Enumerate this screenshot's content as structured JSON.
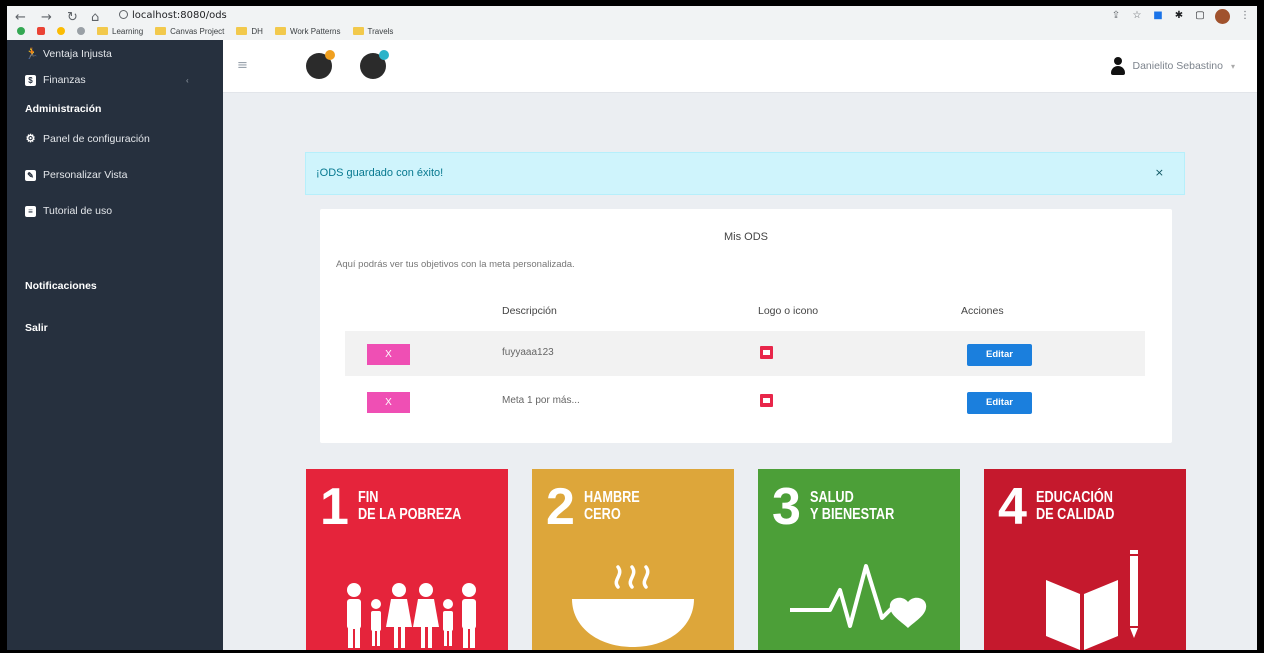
{
  "browser": {
    "url": "localhost:8080/ods",
    "bookmarks": [
      "Learning",
      "Canvas Project",
      "DH",
      "Work Patterns",
      "Travels"
    ]
  },
  "sidebar": {
    "items": [
      {
        "label": "Ventaja Injusta",
        "icon": "running-person-icon"
      },
      {
        "label": "Finanzas",
        "icon": "dollar-icon"
      }
    ],
    "admin_heading": "Administración",
    "admin_items": [
      {
        "label": "Panel de configuración",
        "icon": "gear-icon"
      },
      {
        "label": "Personalizar Vista",
        "icon": "palette-icon"
      },
      {
        "label": "Tutorial de uso",
        "icon": "book-icon"
      }
    ],
    "notifications": "Notificaciones",
    "logout": "Salir"
  },
  "topbar": {
    "user_name": "Danielito Sebastino"
  },
  "alert": {
    "message": "¡ODS guardado con éxito!",
    "close": "×"
  },
  "card": {
    "title": "Mis ODS",
    "description": "Aquí podrás ver tus objetivos con la meta personalizada.",
    "headers": [
      "Descripción",
      "Logo o icono",
      "Acciones"
    ],
    "rows": [
      {
        "delete": "X",
        "description": "fuyyaaa123",
        "action": "Editar"
      },
      {
        "delete": "X",
        "description": "Meta 1 por más...",
        "action": "Editar"
      }
    ]
  },
  "sdgs": [
    {
      "number": "1",
      "title": "FIN\nDE LA POBREZA",
      "color": "#e5243b",
      "icon": "family-icon"
    },
    {
      "number": "2",
      "title": "HAMBRE\nCERO",
      "color": "#dda63a",
      "icon": "bowl-icon"
    },
    {
      "number": "3",
      "title": "SALUD\nY BIENESTAR",
      "color": "#4c9f38",
      "icon": "heartbeat-icon"
    },
    {
      "number": "4",
      "title": "EDUCACIÓN\nDE CALIDAD",
      "color": "#c5192d",
      "icon": "book-pencil-icon"
    }
  ],
  "colors": {
    "sidebar_bg": "#26303e",
    "alert_bg": "#cff4fc",
    "delete_pink": "#ef4fb4",
    "edit_blue": "#1b7fdd"
  }
}
